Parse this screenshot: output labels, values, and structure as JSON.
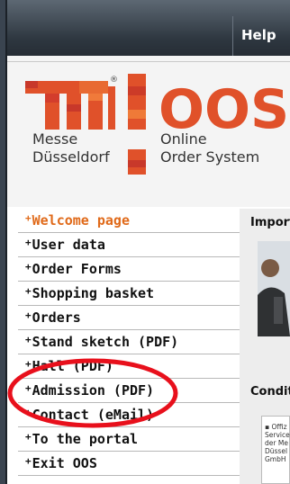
{
  "topbar": {
    "help_label": "Help"
  },
  "logo": {
    "messe_line1": "Messe",
    "messe_line2": "Düsseldorf",
    "oos_big": "OOS",
    "oos_line1": "Online",
    "oos_line2": "Order System",
    "registered": "®"
  },
  "nav": {
    "items": [
      {
        "label": "Welcome page",
        "active": true
      },
      {
        "label": "User data"
      },
      {
        "label": "Order Forms"
      },
      {
        "label": "Shopping basket"
      },
      {
        "label": "Orders"
      },
      {
        "label": "Stand sketch (PDF)"
      },
      {
        "label": "Hall (PDF)"
      },
      {
        "label": "Admission (PDF)"
      },
      {
        "label": "Contact (eMail)"
      },
      {
        "label": "To the portal"
      },
      {
        "label": "Exit OOS"
      }
    ],
    "plus_glyph": "+",
    "active_color": "#e06a1a"
  },
  "content": {
    "heading1": "Import",
    "heading2": "Condit",
    "doc_lines": "▪ Offiz\nService\nder Me\nDüssel\nGmbH"
  },
  "colors": {
    "brand_red": "#e0512a",
    "annotation": "#e8101c"
  }
}
